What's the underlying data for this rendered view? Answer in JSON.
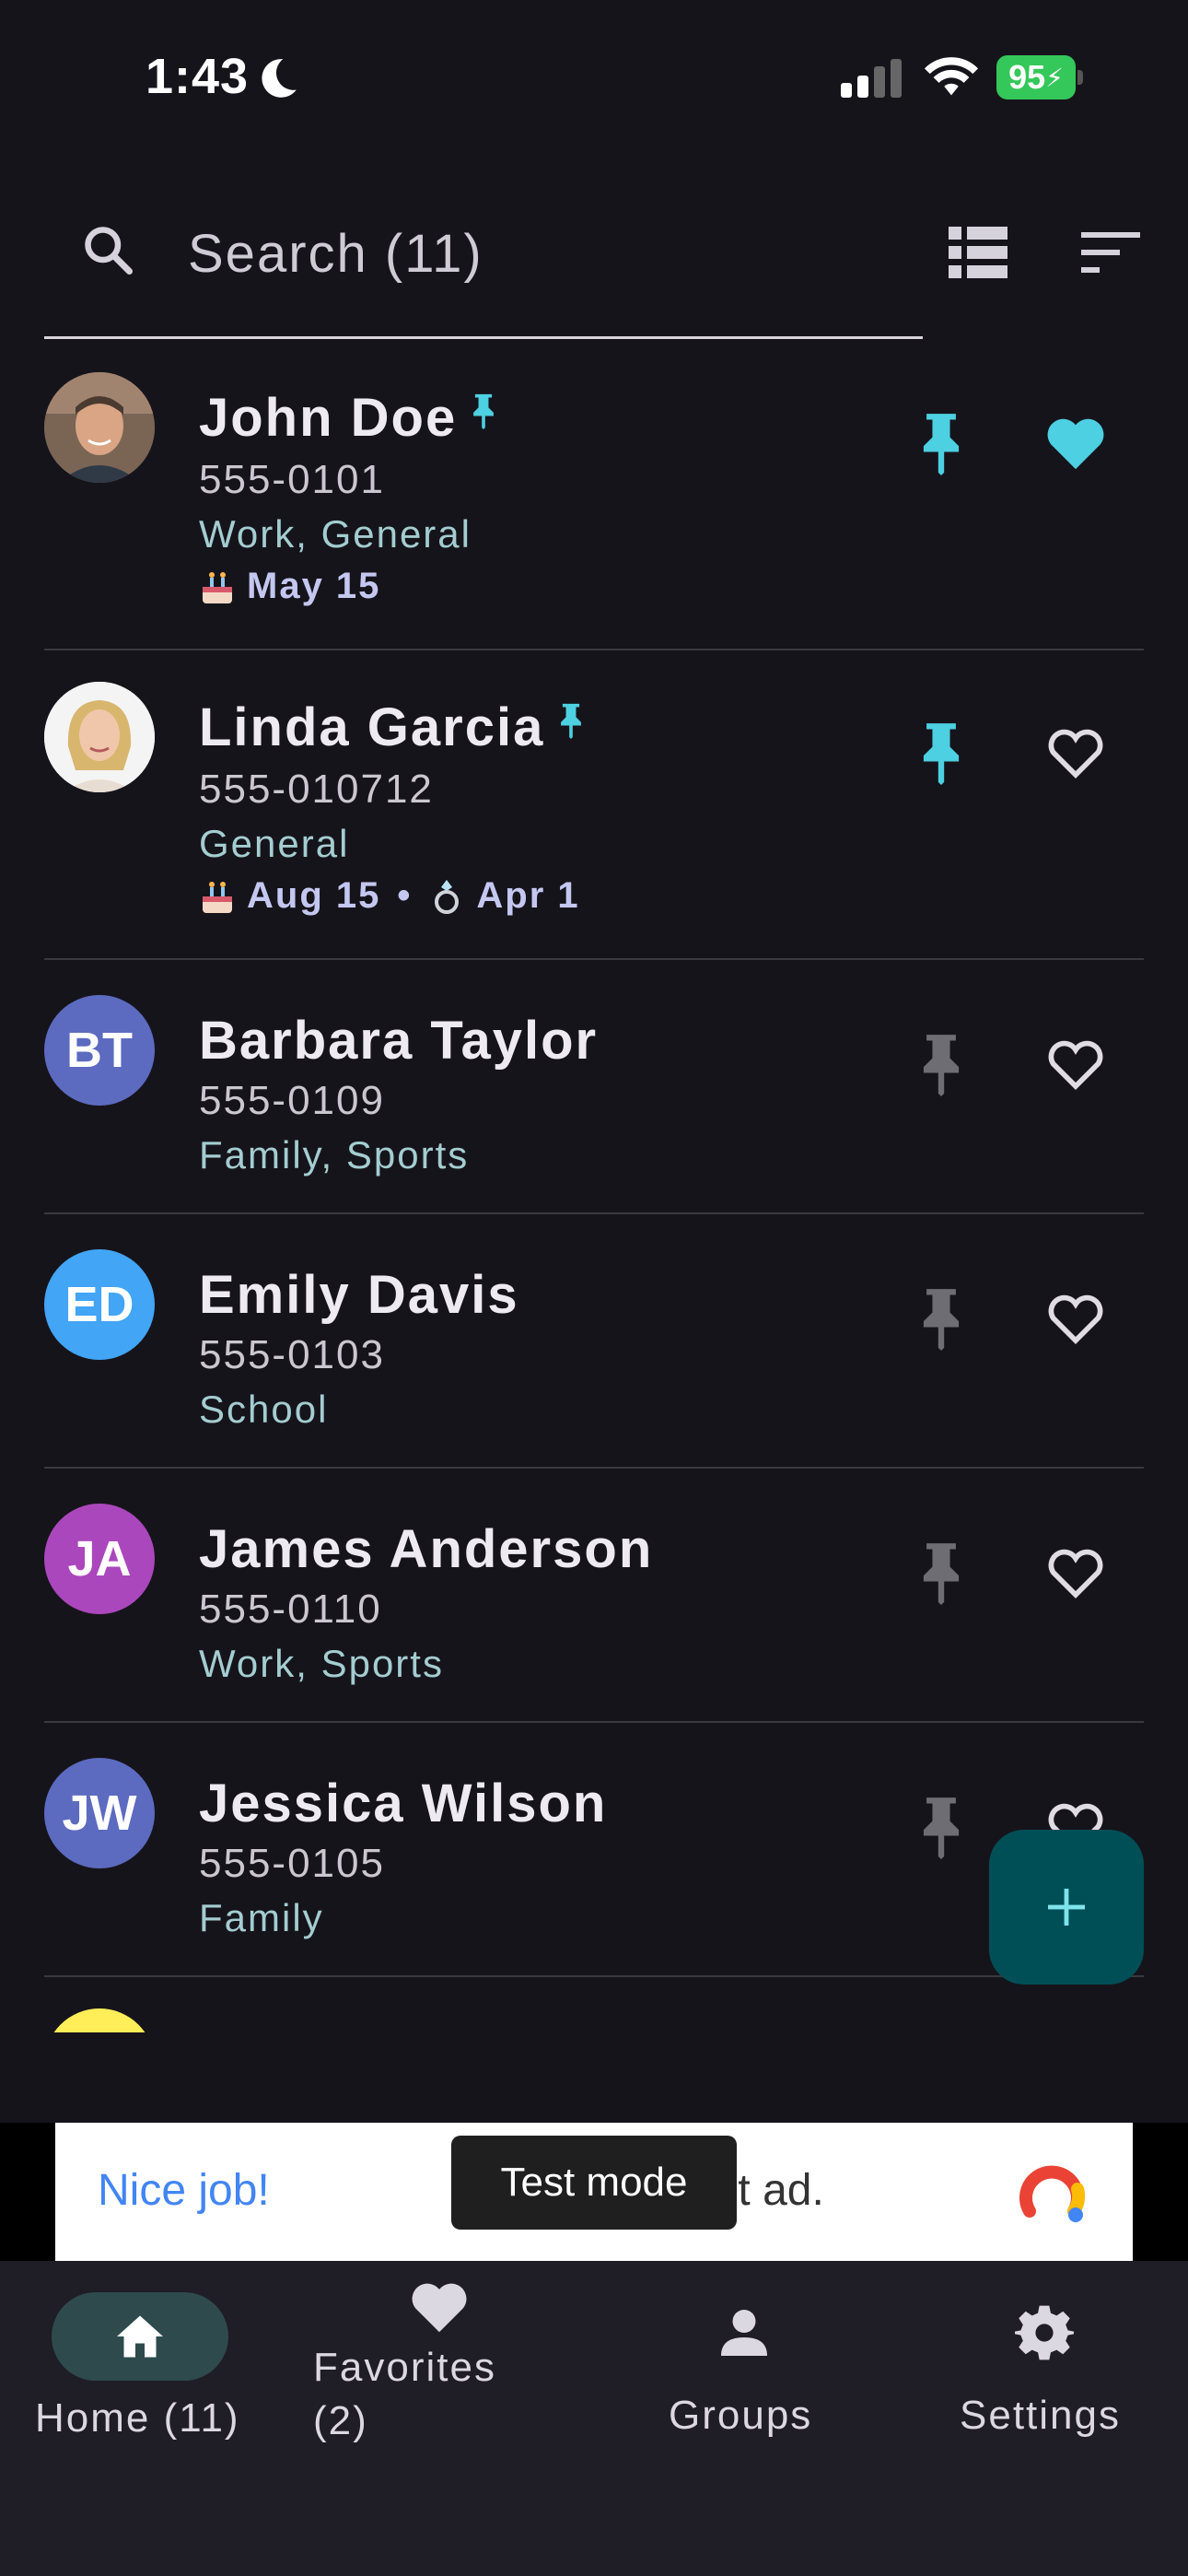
{
  "status_bar": {
    "time": "1:43",
    "battery": "95"
  },
  "search": {
    "placeholder": "Search (11)"
  },
  "contacts": [
    {
      "name": "John Doe",
      "phone": "555-0101",
      "groups": "Work, General",
      "birthday": "May 15",
      "pinned": true,
      "favorite": true,
      "avatar": "photo"
    },
    {
      "name": "Linda Garcia",
      "phone": "555-010712",
      "groups": "General",
      "birthday": "Aug 15",
      "anniversary": "Apr 1",
      "pinned": true,
      "favorite": false,
      "avatar": "photo"
    },
    {
      "name": "Barbara Taylor",
      "phone": "555-0109",
      "groups": "Family, Sports",
      "initials": "BT",
      "color": "#5c6bc0",
      "pinned": false,
      "favorite": false
    },
    {
      "name": "Emily Davis",
      "phone": "555-0103",
      "groups": "School",
      "initials": "ED",
      "color": "#42a5f5",
      "pinned": false,
      "favorite": false
    },
    {
      "name": "James Anderson",
      "phone": "555-0110",
      "groups": "Work, Sports",
      "initials": "JA",
      "color": "#ab47bc",
      "pinned": false,
      "favorite": false
    },
    {
      "name": "Jessica Wilson",
      "phone": "555-0105",
      "groups": "Family",
      "initials": "JW",
      "color": "#5c6bc0",
      "pinned": false,
      "favorite": false
    }
  ],
  "date_separator": "•",
  "ad": {
    "headline": "Nice job!",
    "body_left": "T",
    "body_right": "0 test ad.",
    "test_mode_label": "Test mode"
  },
  "nav": {
    "home": "Home (11)",
    "favorites_line1": "Favorites",
    "favorites_line2": "(2)",
    "groups": "Groups",
    "settings": "Settings"
  },
  "colors": {
    "accent": "#4dd0e1",
    "background": "#16141b",
    "fab": "#004f57",
    "pin_inactive": "#6f6d74"
  }
}
